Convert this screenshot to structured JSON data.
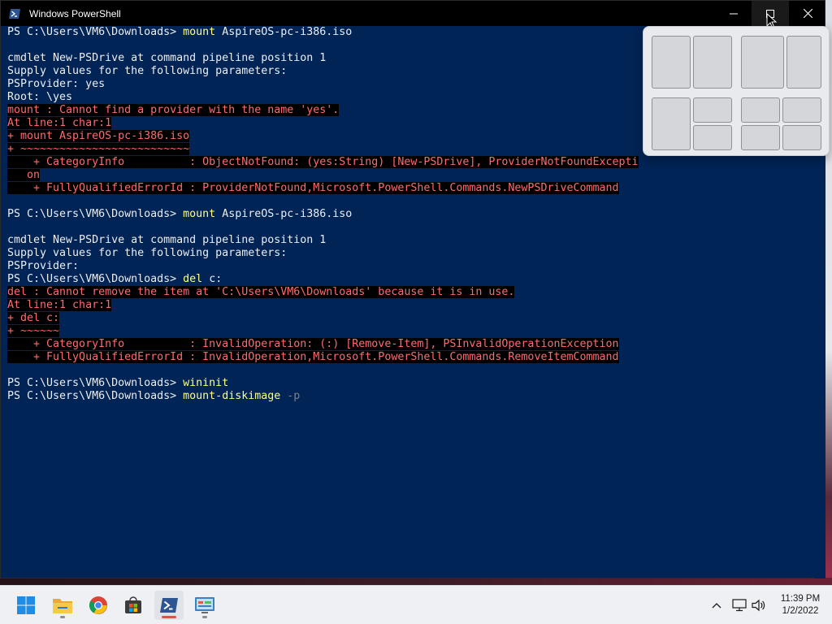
{
  "window": {
    "title": "Windows PowerShell",
    "app_icon": "powershell-icon",
    "buttons": [
      "minimize-icon",
      "maximize-icon",
      "close-icon"
    ]
  },
  "terminal": {
    "lines": [
      {
        "t": "prompt",
        "prompt": "PS C:\\Users\\VM6\\Downloads> ",
        "cmd": "mount",
        "rest": " AspireOS-pc-i386.iso"
      },
      {
        "t": "blank"
      },
      {
        "t": "plain",
        "text": "cmdlet New-PSDrive at command pipeline position 1"
      },
      {
        "t": "plain",
        "text": "Supply values for the following parameters:"
      },
      {
        "t": "plain",
        "text": "PSProvider: yes"
      },
      {
        "t": "plain",
        "text": "Root: \\yes"
      },
      {
        "t": "error",
        "text": "mount : Cannot find a provider with the name 'yes'."
      },
      {
        "t": "error",
        "text": "At line:1 char:1"
      },
      {
        "t": "error",
        "text": "+ mount AspireOS-pc-i386.iso"
      },
      {
        "t": "error",
        "text": "+ ~~~~~~~~~~~~~~~~~~~~~~~~~~"
      },
      {
        "t": "error",
        "text": "    + CategoryInfo          : ObjectNotFound: (yes:String) [New-PSDrive], ProviderNotFoundExcepti"
      },
      {
        "t": "error",
        "text": "   on"
      },
      {
        "t": "error",
        "text": "    + FullyQualifiedErrorId : ProviderNotFound,Microsoft.PowerShell.Commands.NewPSDriveCommand"
      },
      {
        "t": "blank"
      },
      {
        "t": "prompt",
        "prompt": "PS C:\\Users\\VM6\\Downloads> ",
        "cmd": "mount",
        "rest": " AspireOS-pc-i386.iso"
      },
      {
        "t": "blank"
      },
      {
        "t": "plain",
        "text": "cmdlet New-PSDrive at command pipeline position 1"
      },
      {
        "t": "plain",
        "text": "Supply values for the following parameters:"
      },
      {
        "t": "plain",
        "text": "PSProvider:"
      },
      {
        "t": "prompt",
        "prompt": "PS C:\\Users\\VM6\\Downloads> ",
        "cmd": "del",
        "rest": " c:"
      },
      {
        "t": "error",
        "text": "del : Cannot remove the item at 'C:\\Users\\VM6\\Downloads' because it is in use."
      },
      {
        "t": "error",
        "text": "At line:1 char:1"
      },
      {
        "t": "error",
        "text": "+ del c:"
      },
      {
        "t": "error",
        "text": "+ ~~~~~~"
      },
      {
        "t": "error",
        "text": "    + CategoryInfo          : InvalidOperation: (:) [Remove-Item], PSInvalidOperationException"
      },
      {
        "t": "error",
        "text": "    + FullyQualifiedErrorId : InvalidOperation,Microsoft.PowerShell.Commands.RemoveItemCommand"
      },
      {
        "t": "blank"
      },
      {
        "t": "prompt",
        "prompt": "PS C:\\Users\\VM6\\Downloads> ",
        "cmd": "wininit",
        "rest": ""
      },
      {
        "t": "prompt-param",
        "prompt": "PS C:\\Users\\VM6\\Downloads> ",
        "cmd": "mount-diskimage",
        "param": " -p"
      }
    ]
  },
  "snap_layouts": {
    "layouts": [
      "two-equal",
      "two-wide-narrow",
      "three-left-tall",
      "four-grid"
    ]
  },
  "taskbar": {
    "items": [
      {
        "name": "start-button",
        "icon": "windows-logo-icon"
      },
      {
        "name": "file-explorer",
        "icon": "folder-icon"
      },
      {
        "name": "chrome",
        "icon": "chrome-icon"
      },
      {
        "name": "microsoft-store",
        "icon": "store-icon"
      },
      {
        "name": "powershell",
        "icon": "powershell-icon"
      },
      {
        "name": "control-panel",
        "icon": "control-panel-icon"
      }
    ],
    "tray": {
      "icons": [
        "chevron-up-icon",
        "network-icon",
        "volume-icon"
      ],
      "time": "11:39 PM",
      "date": "1/2/2022"
    }
  },
  "colors": {
    "terminal_bg": "#012456",
    "error_fg": "#ff6b6b",
    "command_fg": "#ffff80",
    "param_fg": "#808080"
  }
}
